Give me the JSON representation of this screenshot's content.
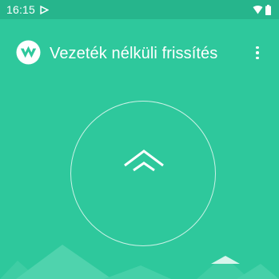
{
  "status_bar": {
    "time": "16:15",
    "icons": [
      "play-icon",
      "wifi-icon",
      "battery-icon"
    ]
  },
  "app_bar": {
    "title": "Vezeték nélküli frissítés",
    "logo": "app-logo",
    "menu_icon": "more-vert-icon"
  },
  "main": {
    "update_button_icon": "double-chevron-up-icon"
  },
  "colors": {
    "background": "#2ec89c",
    "status_bar": "#26b58c",
    "mountain": "#4fd3ad"
  }
}
